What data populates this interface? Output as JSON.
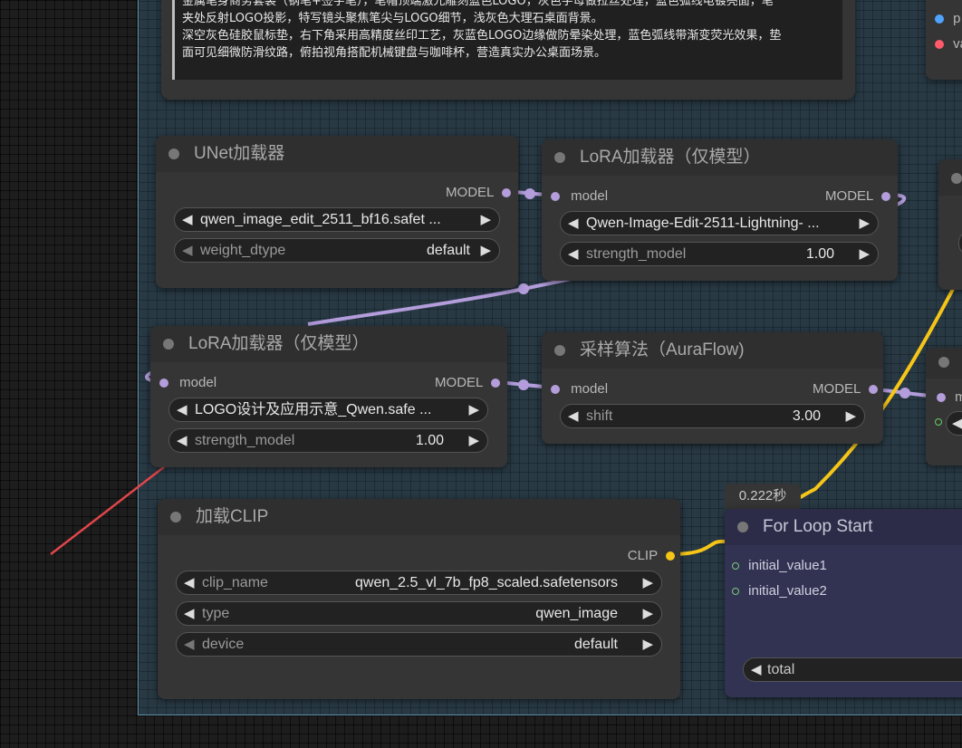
{
  "prompt_node": {
    "text_lines": [
      "金属笔身商务套装（钢笔+签字笔），笔帽顶端激光雕刻蓝色LOGO，灰色字母做拉丝处理，蓝色弧线电镀亮面，笔",
      "夹处反射LOGO投影，特写镜头聚焦笔尖与LOGO细节，浅灰色大理石桌面背景。",
      "深空灰色硅胶鼠标垫，右下角采用高精度丝印工艺，灰蓝色LOGO边缘做防晕染处理，蓝色弧线带渐变荧光效果，垫",
      "面可见细微防滑纹路，俯拍视角搭配机械键盘与咖啡杯，营造真实办公桌面场景。"
    ]
  },
  "unet_loader": {
    "title": "UNet加载器",
    "output": "MODEL",
    "unet_name": "qwen_image_edit_2511_bf16.safet ...",
    "weight_dtype_label": "weight_dtype",
    "weight_dtype_value": "default"
  },
  "lora_loader_1": {
    "title": "LoRA加载器（仅模型）",
    "input": "model",
    "output": "MODEL",
    "lora_name": "Qwen-Image-Edit-2511-Lightning- ...",
    "strength_label": "strength_model",
    "strength_value": "1.00"
  },
  "lora_loader_2": {
    "title": "LoRA加载器（仅模型）",
    "input": "model",
    "output": "MODEL",
    "lora_name": "LOGO设计及应用示意_Qwen.safe ...",
    "strength_label": "strength_model",
    "strength_value": "1.00"
  },
  "sampling_auraflow": {
    "title": "采样算法（AuraFlow)",
    "input": "model",
    "output": "MODEL",
    "shift_label": "shift",
    "shift_value": "3.00"
  },
  "clip_loader": {
    "title": "加载CLIP",
    "output": "CLIP",
    "clip_name_label": "clip_name",
    "clip_name_value": "qwen_2.5_vl_7b_fp8_scaled.safetensors",
    "type_label": "type",
    "type_value": "qwen_image",
    "device_label": "device",
    "device_value": "default"
  },
  "for_loop_start": {
    "timing": "0.222秒",
    "title": "For Loop Start",
    "inputs": [
      "initial_value1",
      "initial_value2"
    ],
    "total_label": "total"
  },
  "right_partial_node_top": {
    "inputs": [
      "p",
      "va"
    ]
  },
  "right_partial_node_mid": {
    "input": "m"
  },
  "colors": {
    "model_link": "#b39ddb",
    "clip_link": "#f5c518",
    "group_bg": "#283944",
    "annotation_arrow": "#e0464a"
  }
}
